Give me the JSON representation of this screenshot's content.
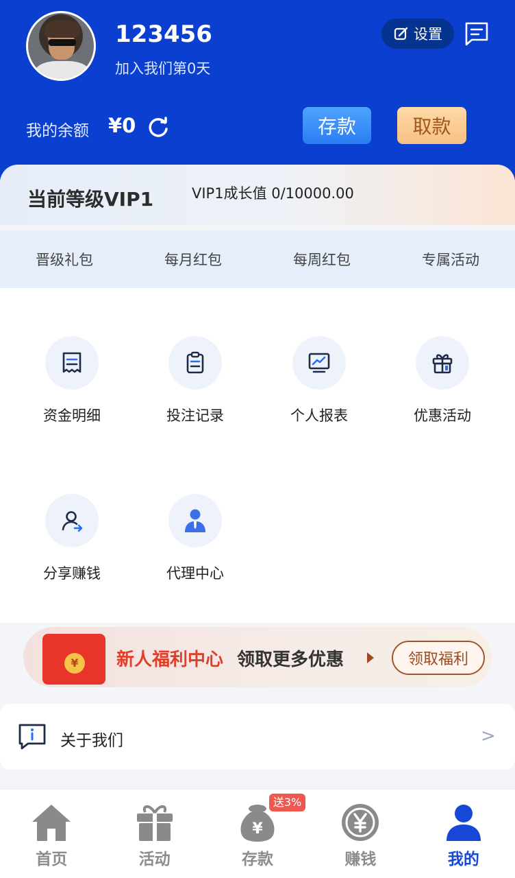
{
  "profile": {
    "username": "123456",
    "joined": "加入我们第0天",
    "settings_label": "设置"
  },
  "balance": {
    "label": "我的余额",
    "value": "¥0",
    "deposit_label": "存款",
    "withdraw_label": "取款"
  },
  "vip": {
    "level": "当前等级VIP1",
    "growth": "VIP1成长值 0/10000.00",
    "tabs": [
      "晋级礼包",
      "每月红包",
      "每周红包",
      "专属活动"
    ]
  },
  "menu": [
    {
      "label": "资金明细",
      "icon": "receipt-icon"
    },
    {
      "label": "投注记录",
      "icon": "clipboard-icon"
    },
    {
      "label": "个人报表",
      "icon": "chart-monitor-icon"
    },
    {
      "label": "优惠活动",
      "icon": "gift-icon"
    },
    {
      "label": "分享赚钱",
      "icon": "share-user-icon"
    },
    {
      "label": "代理中心",
      "icon": "agent-icon"
    }
  ],
  "promo": {
    "title": "新人福利中心",
    "subtitle": "领取更多优惠",
    "button": "领取福利",
    "coin_symbol": "¥"
  },
  "about": {
    "label": "关于我们",
    "chevron": ">"
  },
  "tabbar": {
    "items": [
      {
        "label": "首页",
        "icon": "home-icon"
      },
      {
        "label": "活动",
        "icon": "gift-box-icon"
      },
      {
        "label": "存款",
        "icon": "money-bag-icon",
        "badge": "送3%"
      },
      {
        "label": "赚钱",
        "icon": "yen-coin-icon"
      },
      {
        "label": "我的",
        "icon": "user-icon",
        "active": true
      }
    ]
  },
  "colors": {
    "header_bg": "#0a3fcf",
    "active_tab": "#1747d6",
    "promo_red": "#e0402a"
  }
}
